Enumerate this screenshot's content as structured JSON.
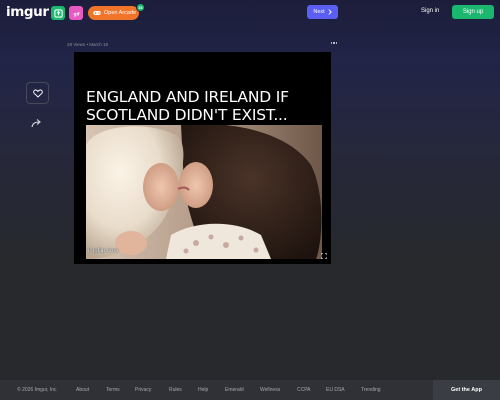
{
  "header": {
    "logo": "imgur",
    "arcade_label": "Open Arcade",
    "arcade_badge": "35",
    "next_label": "Next",
    "signin_label": "Sign in",
    "signup_label": "Sign up"
  },
  "post": {
    "views": "28 Views",
    "separator": "•",
    "date": "March 18",
    "caption": "ENGLAND AND IRELAND IF SCOTLAND DIDN'T EXIST...",
    "watermark": "imgflip.com"
  },
  "footer": {
    "links": [
      "© 2026 Imgur, Inc",
      "About",
      "Terms",
      "Privacy",
      "Rules",
      "Help",
      "Emerald",
      "Wellness",
      "CCPA",
      "EU DSA",
      "Trending"
    ],
    "get_app": "Get the App"
  },
  "colors": {
    "accent_green": "#1bb76e",
    "accent_pink": "#e75bc0",
    "arcade_orange": "#f0752a",
    "next_blue": "#5a5ef2"
  },
  "icons": [
    "upload-icon",
    "gif-icon",
    "controller-icon",
    "chevron-right-icon",
    "more-icon",
    "heart-icon",
    "share-icon",
    "expand-icon"
  ]
}
